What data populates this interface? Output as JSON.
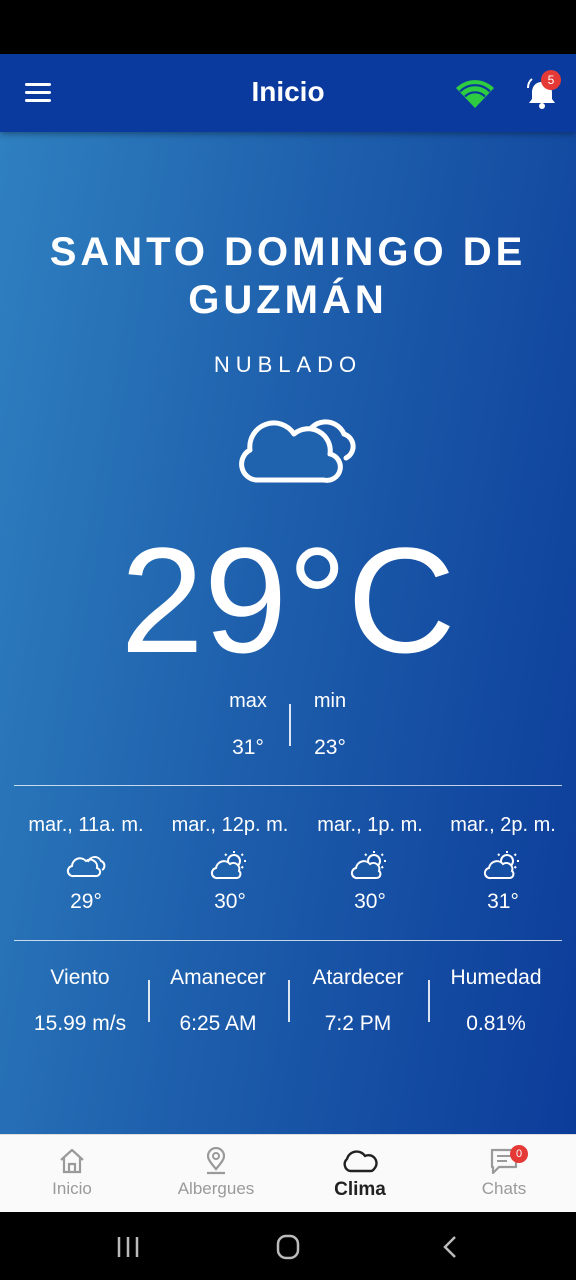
{
  "app_bar": {
    "title": "Inicio",
    "notification_count": "5",
    "wifi_color": "#2ecc40"
  },
  "weather": {
    "city": "SANTO DOMINGO DE GUZMÁN",
    "condition": "NUBLADO",
    "condition_icon": "cloud-icon",
    "temperature": "29°C",
    "max_label": "max",
    "min_label": "min",
    "max_value": "31°",
    "min_value": "23°"
  },
  "hourly": [
    {
      "time": "mar., 11a. m.",
      "icon": "cloud-icon",
      "temp": "29°"
    },
    {
      "time": "mar., 12p. m.",
      "icon": "partly-sunny-icon",
      "temp": "30°"
    },
    {
      "time": "mar., 1p. m.",
      "icon": "partly-sunny-icon",
      "temp": "30°"
    },
    {
      "time": "mar., 2p. m.",
      "icon": "partly-sunny-icon",
      "temp": "31°"
    }
  ],
  "stats": [
    {
      "label": "Viento",
      "value": "15.99 m/s"
    },
    {
      "label": "Amanecer",
      "value": "6:25 AM"
    },
    {
      "label": "Atardecer",
      "value": "7:2 PM"
    },
    {
      "label": "Humedad",
      "value": "0.81%"
    }
  ],
  "bottom_nav": {
    "items": [
      {
        "label": "Inicio",
        "icon": "home-icon"
      },
      {
        "label": "Albergues",
        "icon": "location-pin-icon"
      },
      {
        "label": "Clima",
        "icon": "cloud-icon"
      },
      {
        "label": "Chats",
        "icon": "chat-icon"
      }
    ],
    "active": "Clima",
    "chat_badge": "0"
  },
  "colors": {
    "app_bar": "#0a3a9e",
    "gradient_start": "#2f80c0",
    "gradient_end": "#0c3c9a",
    "badge": "#e53935"
  }
}
